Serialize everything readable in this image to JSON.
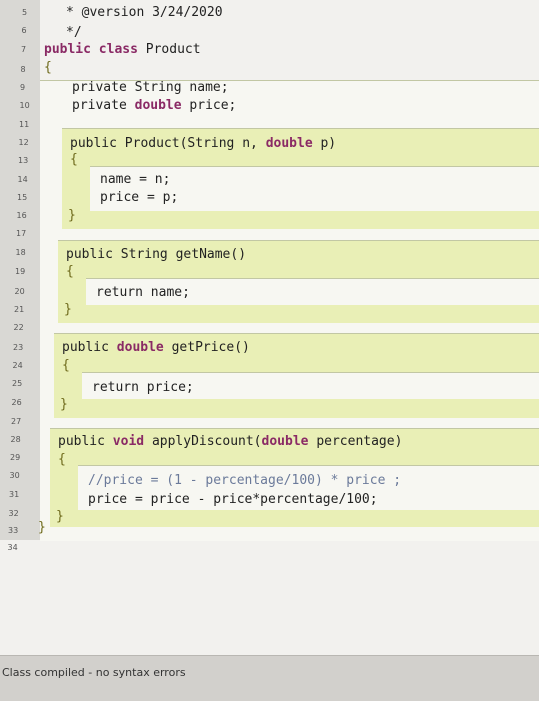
{
  "editor": {
    "line_numbers": [
      "5",
      "6",
      "7",
      "8",
      "9",
      "10",
      "11",
      "12",
      "13",
      "14",
      "15",
      "16",
      "17",
      "18",
      "19",
      "20",
      "21",
      "22",
      "23",
      "24",
      "25",
      "26",
      "27",
      "28",
      "29",
      "30",
      "31",
      "32",
      "33",
      "34"
    ],
    "code": {
      "l5": "* @version 3/24/2020",
      "l6": "*/",
      "l7_kw1": "public",
      "l7_kw2": "class",
      "l7_name": "Product",
      "l8": "{",
      "l9_kw": "private",
      "l9_rest": "String name;",
      "l10_kw1": "private",
      "l10_kw2": "double",
      "l10_rest": "price;",
      "l12_kw": "public",
      "l12_mid": "Product(String n,",
      "l12_kw2": "double",
      "l12_end": "p)",
      "l13": "{",
      "l14": "name = n;",
      "l15": "price = p;",
      "l16": "}",
      "l18_kw": "public",
      "l18_rest": "String getName()",
      "l19": "{",
      "l20_kw": "return",
      "l20_rest": "name;",
      "l21": "}",
      "l23_kw1": "public",
      "l23_kw2": "double",
      "l23_rest": "getPrice()",
      "l24": "{",
      "l25_kw": "return",
      "l25_rest": "price;",
      "l26": "}",
      "l28_kw1": "public",
      "l28_kw2": "void",
      "l28_mid": "applyDiscount(",
      "l28_kw3": "double",
      "l28_end": "percentage)",
      "l29": "{",
      "l30": "//price = (1 - percentage/100) * price ;",
      "l31": "price = price - price*percentage/100;",
      "l32": "}",
      "l33": "}"
    }
  },
  "status_bar": {
    "message": "Class compiled - no syntax errors"
  },
  "colors": {
    "keyword": "#8a2a65",
    "comment": "#6b7a9a",
    "method_band": "#e9efb6",
    "body_band": "#f7f7f2"
  }
}
